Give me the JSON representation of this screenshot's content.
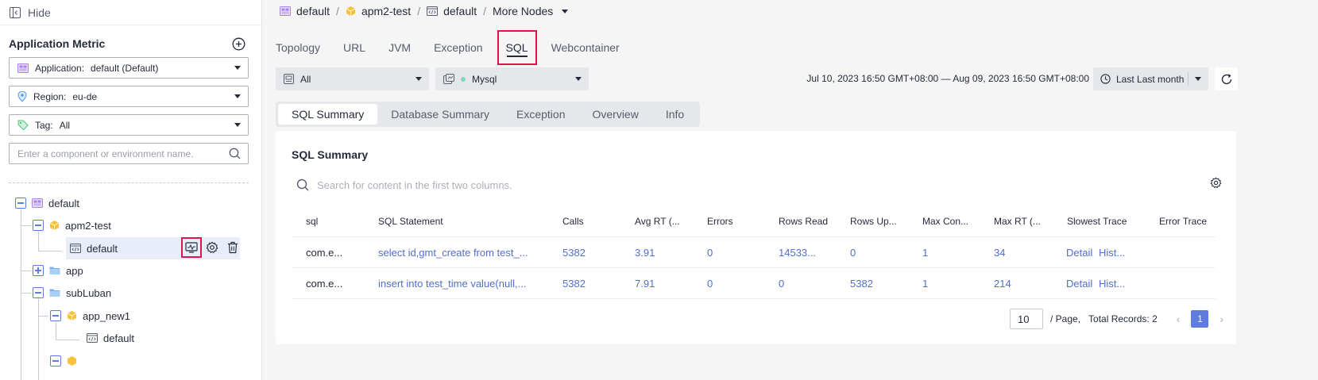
{
  "sidebar": {
    "hide_label": "Hide",
    "title": "Application Metric",
    "application_label": "Application:",
    "application_value": "default (Default)",
    "region_label": "Region:",
    "region_value": "eu-de",
    "tag_label": "Tag:",
    "tag_value": "All",
    "search_placeholder": "Enter a component or environment name.",
    "tree": {
      "root": "default",
      "apm2_test": "apm2-test",
      "apm2_default": "default",
      "app": "app",
      "sub_luban": "subLuban",
      "app_new1": "app_new1",
      "app_new1_default": "default"
    }
  },
  "breadcrumb": {
    "item1": "default",
    "sep": "/",
    "item2": "apm2-test",
    "item3": "default",
    "item4": "More Nodes"
  },
  "main_tabs": [
    "Topology",
    "URL",
    "JVM",
    "Exception",
    "SQL",
    "Webcontainer"
  ],
  "filters": {
    "scope_value": "All",
    "db_value": "Mysql",
    "time_range": "Jul 10, 2023 16:50 GMT+08:00 — Aug 09, 2023 16:50 GMT+08:00",
    "time_preset": "Last Last month"
  },
  "sub_tabs": [
    "SQL Summary",
    "Database Summary",
    "Exception",
    "Overview",
    "Info"
  ],
  "card": {
    "title": "SQL Summary",
    "search_placeholder": "Search for content in the first two columns."
  },
  "table": {
    "columns": [
      "sql",
      "SQL Statement",
      "Calls",
      "Avg RT (...",
      "Errors",
      "Rows Read",
      "Rows Up...",
      "Max Con...",
      "Max RT (...",
      "Slowest Trace",
      "Error Trace"
    ],
    "rows": [
      {
        "sql": "com.e...",
        "statement": "select id,gmt_create from test_...",
        "calls": "5382",
        "avg_rt": "3.91",
        "errors": "0",
        "rows_read": "14533...",
        "rows_up": "0",
        "max_con": "1",
        "max_rt": "34",
        "detail": "Detail",
        "hist": "Hist..."
      },
      {
        "sql": "com.e...",
        "statement": "insert into test_time value(null,...",
        "calls": "5382",
        "avg_rt": "7.91",
        "errors": "0",
        "rows_read": "0",
        "rows_up": "5382",
        "max_con": "1",
        "max_rt": "214",
        "detail": "Detail",
        "hist": "Hist..."
      }
    ]
  },
  "pager": {
    "page_size": "10",
    "per_page": "/ Page,",
    "total": "Total Records: 2",
    "current": "1",
    "prev": "‹",
    "next": "›"
  },
  "colors": {
    "accent": "#5e7ce0",
    "link": "#526ecc",
    "highlight": "#e0164b",
    "app_icon": "#f8c33a",
    "folder_icon": "#7ab3ef",
    "env_icon": "#a785e8"
  }
}
